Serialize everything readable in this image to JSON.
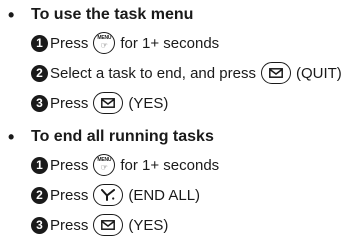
{
  "sections": [
    {
      "bullet": "•",
      "heading": "To use the task menu",
      "steps": [
        {
          "num": "1",
          "before": "Press",
          "after": "for 1+ seconds"
        },
        {
          "num": "2",
          "before": "Select a task to end, and press",
          "after": "(QUIT)"
        },
        {
          "num": "3",
          "before": "Press",
          "after": "(YES)"
        }
      ]
    },
    {
      "bullet": "•",
      "heading": "To end all running tasks",
      "steps": [
        {
          "num": "1",
          "before": "Press",
          "after": "for 1+ seconds"
        },
        {
          "num": "2",
          "before": "Press",
          "after": "(END ALL)"
        },
        {
          "num": "3",
          "before": "Press",
          "after": "(YES)"
        }
      ]
    }
  ],
  "keys": {
    "menu_top": "MENU",
    "menu_bottom": "☞",
    "mail_icon": "mail-key-icon",
    "yahoo_icon": "yahoo-key-icon",
    "menu_icon": "menu-key-icon"
  }
}
